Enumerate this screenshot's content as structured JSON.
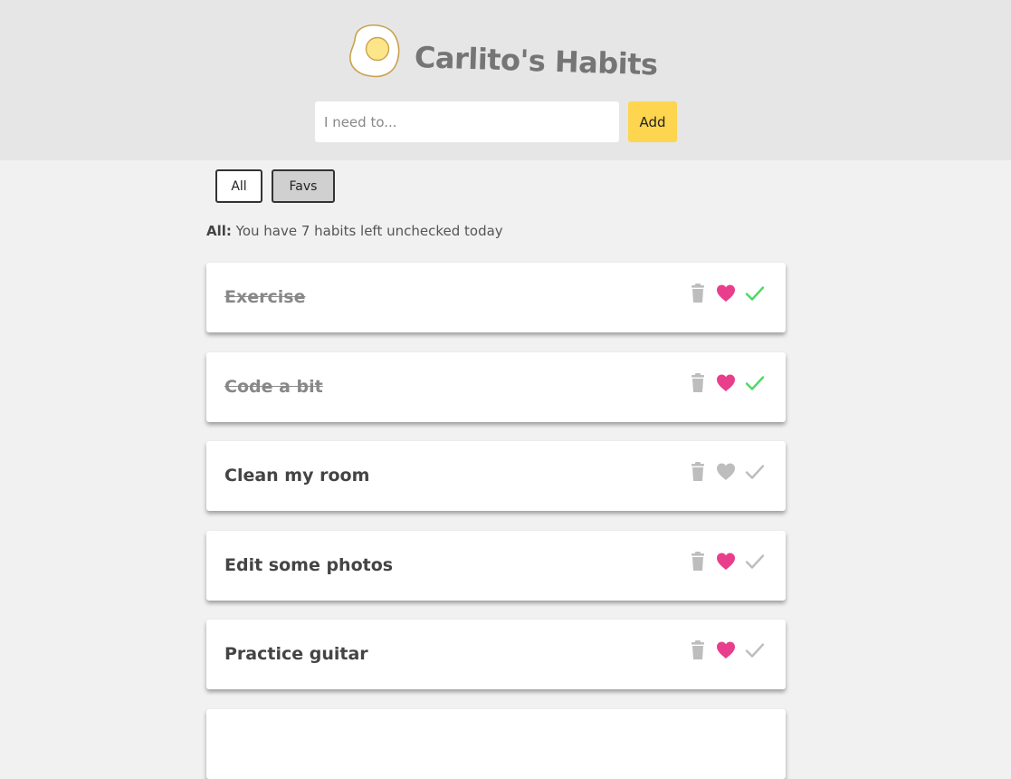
{
  "header": {
    "title": "Carlito's Habits",
    "logo_icon": "fried-egg-icon",
    "input_placeholder": "I need to...",
    "input_value": "",
    "add_label": "Add"
  },
  "filters": {
    "all_label": "All",
    "favs_label": "Favs",
    "selected": "Favs"
  },
  "summary": {
    "label": "All:",
    "text": "You have 7 habits left unchecked today"
  },
  "colors": {
    "accent": "#fdd54f",
    "heart_active": "#e83e8c",
    "check_active": "#4cd964",
    "icon_inactive": "#bdbdbd"
  },
  "habits": [
    {
      "text": "Exercise",
      "done": true,
      "favorite": true
    },
    {
      "text": "Code a bit",
      "done": true,
      "favorite": true
    },
    {
      "text": "Clean my room",
      "done": false,
      "favorite": false
    },
    {
      "text": "Edit some photos",
      "done": false,
      "favorite": true
    },
    {
      "text": "Practice guitar",
      "done": false,
      "favorite": true
    }
  ]
}
